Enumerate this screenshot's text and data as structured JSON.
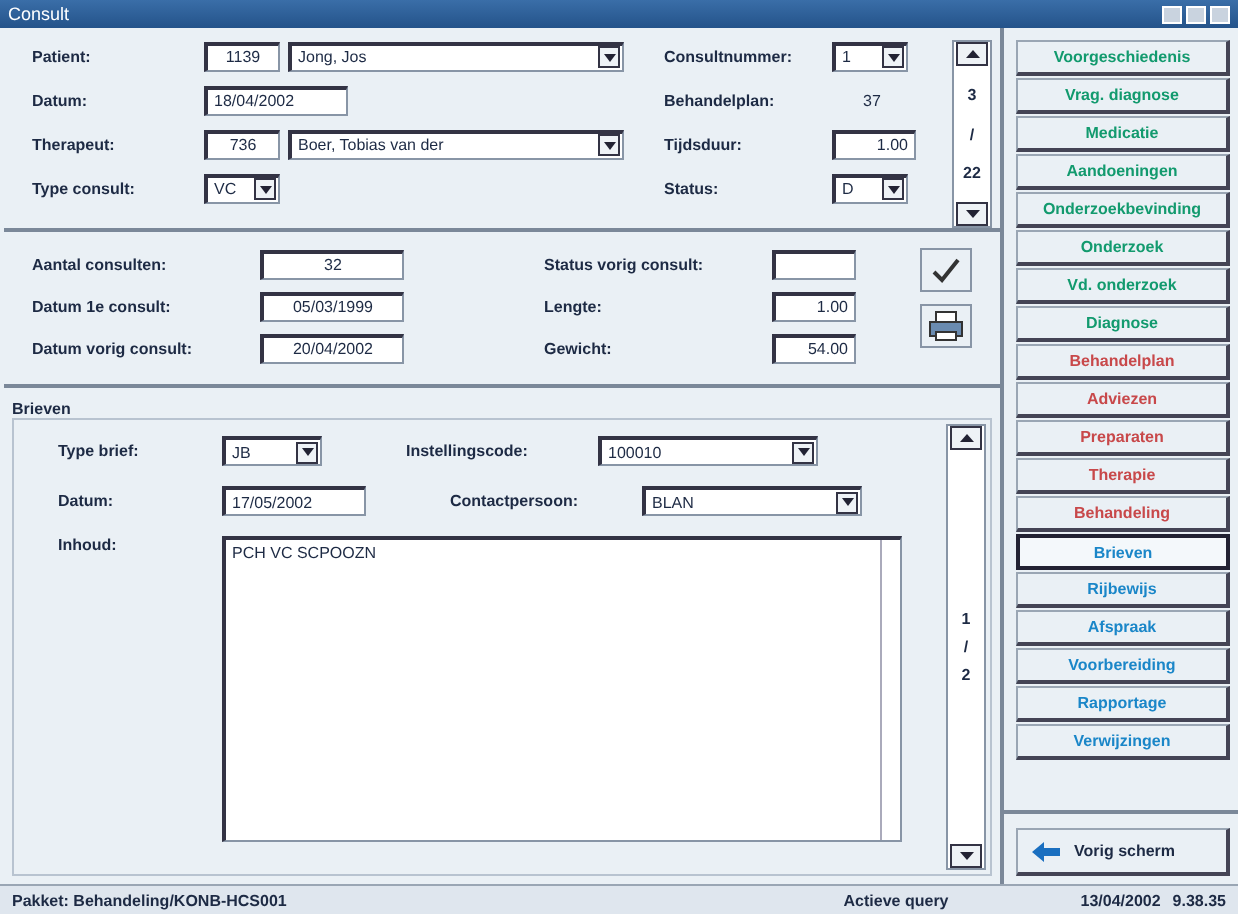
{
  "window": {
    "title": "Consult"
  },
  "consult": {
    "left": [
      {
        "label": "Patient:",
        "code": "1139",
        "value": "Jong, Jos",
        "kind": "combo"
      },
      {
        "label": "Datum:",
        "value": "18/04/2002",
        "kind": "text"
      },
      {
        "label": "Therapeut:",
        "code": "736",
        "value": "Boer, Tobias van der",
        "kind": "combo"
      },
      {
        "label": "Type consult:",
        "value": "VC",
        "kind": "small-combo"
      }
    ],
    "right": [
      {
        "label": "Consultnummer:",
        "value": "1",
        "kind": "small-combo"
      },
      {
        "label": "Behandelplan:",
        "value": "37",
        "kind": "plain"
      },
      {
        "label": "Tijdsduur:",
        "value": "1.00",
        "kind": "number"
      },
      {
        "label": "Status:",
        "value": "D",
        "kind": "small-combo"
      }
    ],
    "pager": {
      "current": "3",
      "sep": "/",
      "total": "22"
    }
  },
  "history": {
    "left": [
      {
        "label": "Aantal consulten:",
        "value": "32"
      },
      {
        "label": "Datum 1e consult:",
        "value": "05/03/1999"
      },
      {
        "label": "Datum vorig consult:",
        "value": "20/04/2002"
      }
    ],
    "right": [
      {
        "label": "Status vorig consult:"
      },
      {
        "label": "Lengte:",
        "value": "1.00"
      },
      {
        "label": "Gewicht:",
        "value": "54.00"
      }
    ]
  },
  "letters": {
    "title": "Brieven",
    "type_label": "Type brief:",
    "type_value": "JB",
    "code_label": "Instellingscode:",
    "code_value": "100010",
    "date_label": "Datum:",
    "date_value": "17/05/2002",
    "contact_label": "Contactpersoon:",
    "contact_value": "BLAN",
    "content_label": "Inhoud:",
    "content_value": "PCH VC SCPOOZN",
    "pager": {
      "current": "1",
      "sep": "/",
      "total": "2"
    }
  },
  "sidebar": {
    "items": [
      {
        "label": "Voorgeschiedenis",
        "color": "#129a6e",
        "selected": false
      },
      {
        "label": "Vrag. diagnose",
        "color": "#129a6e",
        "selected": false
      },
      {
        "label": "Medicatie",
        "color": "#129a6e",
        "selected": false
      },
      {
        "label": "Aandoeningen",
        "color": "#129a6e",
        "selected": false
      },
      {
        "label": "Onderzoekbevinding",
        "color": "#129a6e",
        "selected": false
      },
      {
        "label": "Onderzoek",
        "color": "#129a6e",
        "selected": false
      },
      {
        "label": "Vd. onderzoek",
        "color": "#129a6e",
        "selected": false
      },
      {
        "label": "Diagnose",
        "color": "#129a6e",
        "selected": false
      },
      {
        "label": "Behandelplan",
        "color": "#c8484a",
        "selected": false
      },
      {
        "label": "Adviezen",
        "color": "#c8484a",
        "selected": false
      },
      {
        "label": "Preparaten",
        "color": "#c8484a",
        "selected": false
      },
      {
        "label": "Therapie",
        "color": "#c8484a",
        "selected": false
      },
      {
        "label": "Behandeling",
        "color": "#c8484a",
        "selected": false
      },
      {
        "label": "Brieven",
        "color": "#1a86c8",
        "selected": true
      },
      {
        "label": "Rijbewijs",
        "color": "#1a86c8",
        "selected": false
      },
      {
        "label": "Afspraak",
        "color": "#1a86c8",
        "selected": false
      },
      {
        "label": "Voorbereiding",
        "color": "#1a86c8",
        "selected": false
      },
      {
        "label": "Rapportage",
        "color": "#1a86c8",
        "selected": false
      },
      {
        "label": "Verwijzingen",
        "color": "#1a86c8",
        "selected": false
      }
    ],
    "back": "Vorig scherm"
  },
  "status_bar": {
    "package": "Pakket: Behandeling/KONB-HCS001",
    "query": "Actieve query",
    "date": "13/04/2002",
    "time": "9.38.35"
  }
}
